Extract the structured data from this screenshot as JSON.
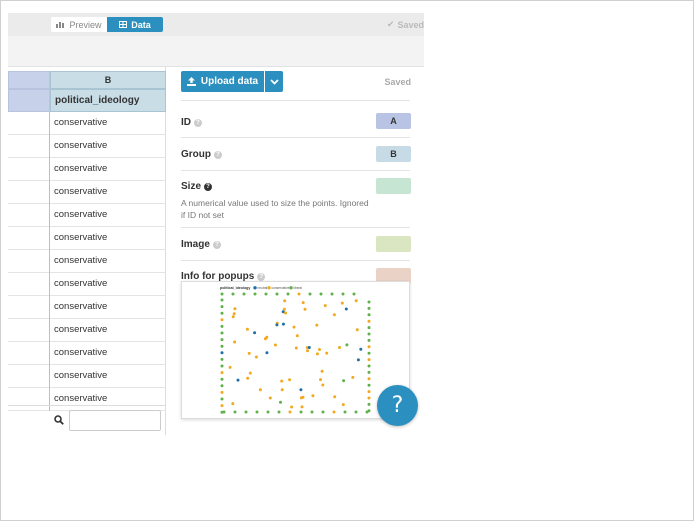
{
  "tabs": {
    "preview_label": "Preview",
    "data_label": "Data"
  },
  "top_status": "Saved",
  "sheet": {
    "column_letter": "B",
    "column_header": "political_ideology",
    "cells": [
      "conservative",
      "conservative",
      "conservative",
      "conservative",
      "conservative",
      "conservative",
      "conservative",
      "conservative",
      "conservative",
      "conservative",
      "conservative",
      "conservative",
      "conservative"
    ],
    "search_value": ""
  },
  "panel": {
    "upload_label": "Upload data",
    "status": "Saved",
    "fields": [
      {
        "label": "ID",
        "column": "A",
        "color": "#b9c3e3"
      },
      {
        "label": "Group",
        "column": "B",
        "color": "#c7dbe6"
      },
      {
        "label": "Size",
        "column": "",
        "color": "#c6e6d3",
        "description": "A numerical value used to size the points. Ignored if ID not set"
      },
      {
        "label": "Image",
        "column": "",
        "color": "#d9e6c1"
      },
      {
        "label": "Info for popups",
        "column": "",
        "color": "#ead3c6"
      }
    ]
  },
  "preview_chart": {
    "legend_title": "political_ideology",
    "legend_items": [
      {
        "name": "neutral",
        "color": "#1f6fa8"
      },
      {
        "name": "conservative",
        "color": "#f2a91e"
      },
      {
        "name": "liberal",
        "color": "#5fb14a"
      }
    ]
  },
  "help_button_label": "?"
}
